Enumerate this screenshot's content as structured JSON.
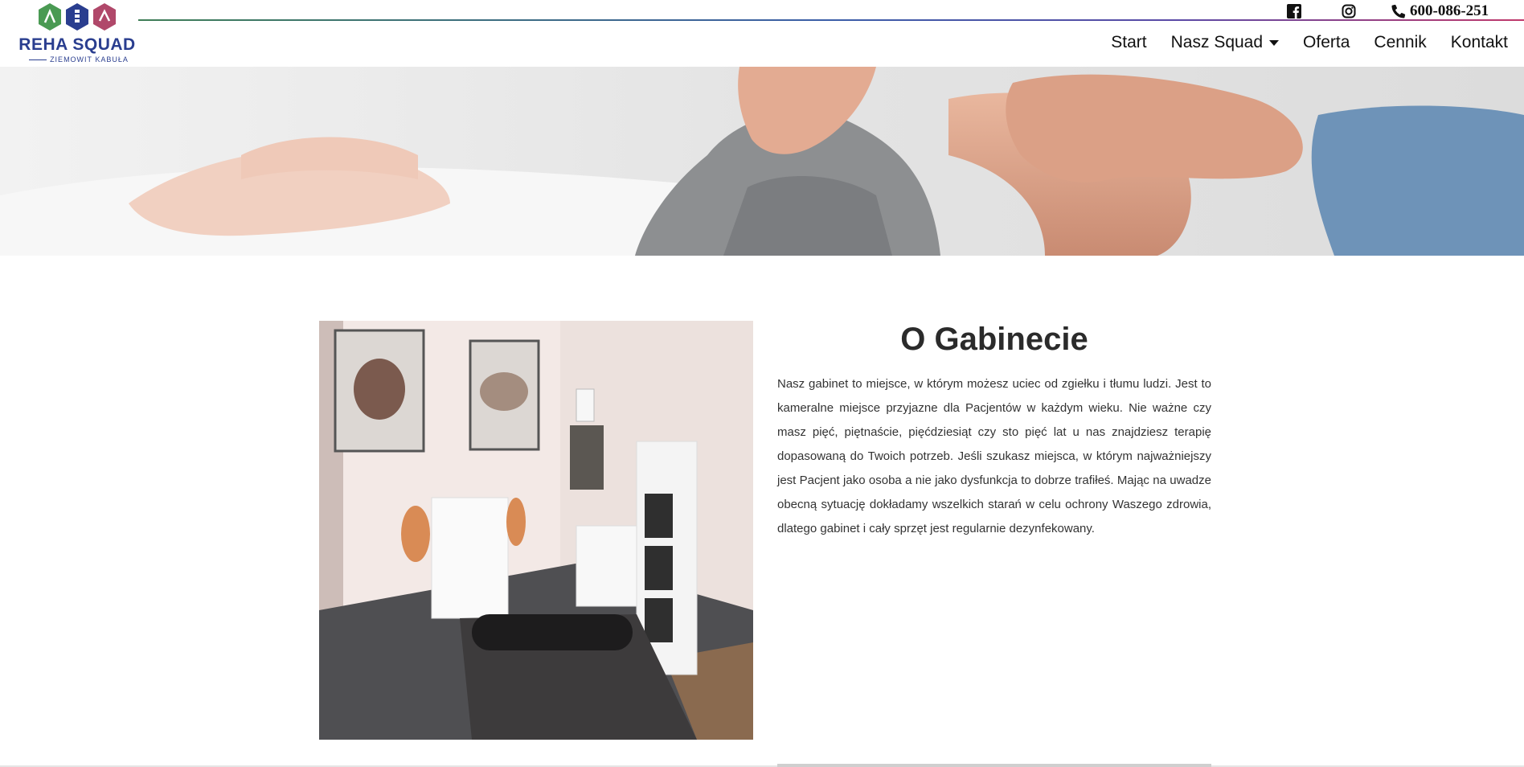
{
  "brand": {
    "name": "REHA SQUAD",
    "subtitle": "ZIEMOWIT KABUŁA",
    "colors": {
      "green": "#4a9a53",
      "blue": "#2a3e8f",
      "magenta": "#b0486a"
    }
  },
  "topbar": {
    "facebook_icon": "facebook-square-icon",
    "instagram_icon": "instagram-icon",
    "phone_icon": "phone-icon",
    "phone": "600-086-251"
  },
  "nav": {
    "items": [
      {
        "label": "Start"
      },
      {
        "label": "Nasz Squad",
        "dropdown": true
      },
      {
        "label": "Oferta"
      },
      {
        "label": "Cennik"
      },
      {
        "label": "Kontakt"
      }
    ]
  },
  "about": {
    "title": "O Gabinecie",
    "text": "Nasz gabinet to miejsce, w którym możesz uciec od zgiełku i tłumu ludzi. Jest to kameralne miejsce przyjazne dla Pacjentów w każdym wieku. Nie ważne czy masz pięć, piętnaście, pięćdziesiąt czy sto pięć lat u nas znajdziesz terapię dopasowaną do Twoich potrzeb. Jeśli szukasz miejsca, w którym najważniejszy jest Pacjent jako osoba a nie jako dysfunkcja to dobrze trafiłeś. Mając na uwadze obecną sytuację dokładamy wszelkich starań w celu ochrony Waszego zdrowia, dlatego gabinet i cały sprzęt jest regularnie dezynfekowany."
  }
}
